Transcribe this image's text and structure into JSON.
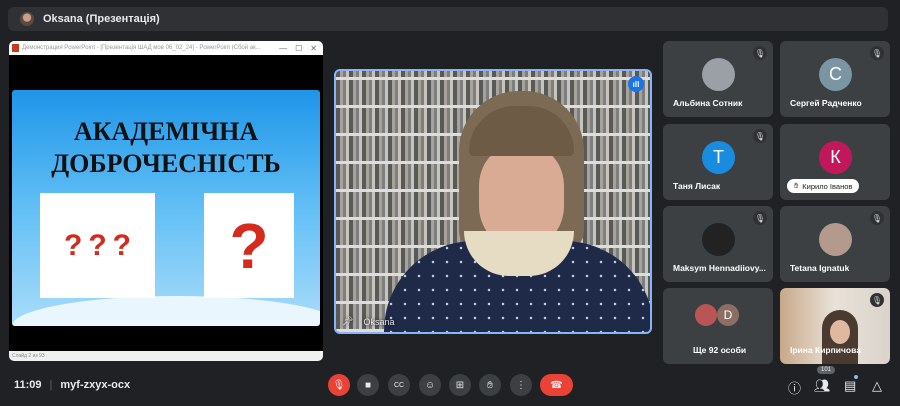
{
  "topbar": {
    "presenter": "Oksana (Презентація)"
  },
  "ppt": {
    "title": "Демонстрация PowerPoint - [Презентація ШАД мов 06_02_24] - PowerPoint (Сбой ак...",
    "minimize": "—",
    "maximize": "☐",
    "close": "✕",
    "slide_title_1": "АКАДЕМІЧНА",
    "slide_title_2": "ДОБРОЧЕСНІСТЬ",
    "status": "Слайд 2 из 93"
  },
  "video": {
    "name": "Oksana"
  },
  "participants": [
    {
      "name": "Альбина Сотник",
      "initial": "",
      "color": "#9aa0a6"
    },
    {
      "name": "Сергей Радченко",
      "initial": "С",
      "color": "#7c95a3"
    },
    {
      "name": "Таня Лисак",
      "initial": "Т",
      "color": "#1a8ce0"
    },
    {
      "name": "Кирило Іванов",
      "initial": "К",
      "color": "#c2185b"
    },
    {
      "name": "Maksym Hennadiiovy...",
      "initial": "",
      "color": "#222"
    },
    {
      "name": "Tetana Ignatuk",
      "initial": "",
      "color": "#b49a8c"
    },
    {
      "name": "Ще 92 особи",
      "initial": "D",
      "color": "#8d6e63"
    },
    {
      "name": "Ірина Кирпичова",
      "initial": "",
      "color": ""
    }
  ],
  "footer": {
    "time": "11:09",
    "separator": "|",
    "meeting_code": "myf-zxyx-ocx",
    "people_count": "101"
  },
  "colors": {
    "accent": "#8ab4f8",
    "danger": "#ea4335"
  }
}
